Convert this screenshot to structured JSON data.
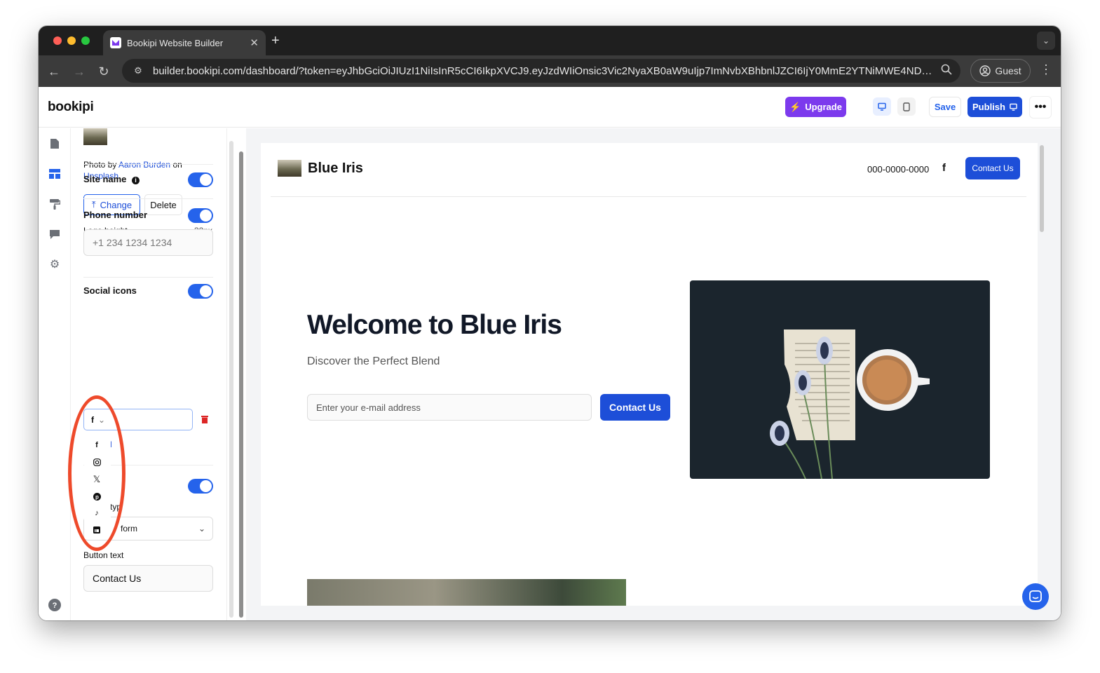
{
  "browser": {
    "tab_title": "Bookipi Website Builder",
    "url": "builder.bookipi.com/dashboard/?token=eyJhbGciOiJIUzI1NiIsInR5cCI6IkpXVCJ9.eyJzdWIiOnsic3Vic2NyaXB0aW9uIjp7ImNvbXBhbnlJZCI6IjY0MmE2YTNiMWE4NDliMDAw...",
    "profile_label": "Guest"
  },
  "app": {
    "logo": "bookipi",
    "upgrade_label": "Upgrade",
    "save_label": "Save",
    "publish_label": "Publish"
  },
  "panel": {
    "photo_by": "Photo by",
    "photo_author": "Aaron Burden",
    "photo_on": "on",
    "photo_source": "Unsplash",
    "change_label": "Change",
    "delete_label": "Delete",
    "logo_height_label": "Logo height",
    "logo_height_value": "32px",
    "site_name_label": "Site name",
    "phone_number_label": "Phone number",
    "phone_placeholder": "+1 234 1234 1234",
    "social_icons_label": "Social icons",
    "social_icons_selected": "f",
    "partial_add_link": "l",
    "partial_type_label": "typ",
    "partial_type_value": "form",
    "button_text_label": "Button text",
    "button_text_value": "Contact Us"
  },
  "social_dropdown": [
    "facebook-icon",
    "instagram-icon",
    "x-icon",
    "pinterest-icon",
    "tiktok-icon",
    "linkedin-icon"
  ],
  "site": {
    "name": "Blue Iris",
    "phone": "000-0000-0000",
    "header_button": "Contact Us",
    "hero_title": "Welcome to Blue Iris",
    "hero_subtitle": "Discover the Perfect Blend",
    "email_placeholder": "Enter your e-mail address",
    "hero_button": "Contact Us"
  },
  "colors": {
    "accent": "#2563eb",
    "upgrade": "#7c3aed",
    "annotation": "#ee4a2b",
    "hero_image_bg": "#1b252d"
  }
}
